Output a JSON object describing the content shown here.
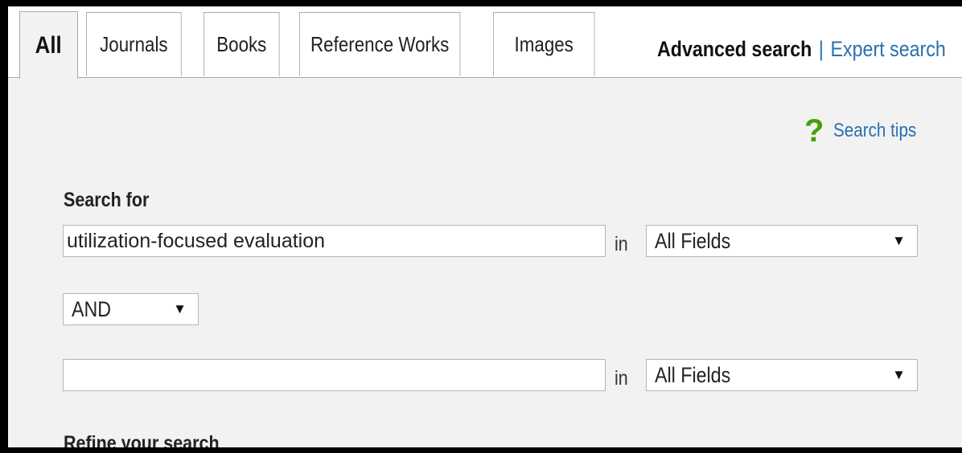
{
  "tabs": {
    "active": "All",
    "items": [
      "Journals",
      "Books",
      "Reference Works",
      "Images"
    ]
  },
  "top_links": {
    "advanced": "Advanced search",
    "separator": "|",
    "expert": "Expert search"
  },
  "search_tips": {
    "icon": "?",
    "label": "Search tips"
  },
  "search": {
    "heading": "Search for",
    "row1": {
      "value": "utilization-focused evaluation",
      "in_label": "in",
      "field": "All Fields"
    },
    "operator": "AND",
    "row2": {
      "value": "",
      "in_label": "in",
      "field": "All Fields"
    }
  },
  "refine": {
    "heading": "Refine your search"
  },
  "colors": {
    "link": "#2a6fb0",
    "help_icon": "#45a000",
    "panel": "#f2f2f2"
  },
  "icons": {
    "help": "question-mark-icon",
    "dropdown": "dropdown-arrow-icon"
  }
}
